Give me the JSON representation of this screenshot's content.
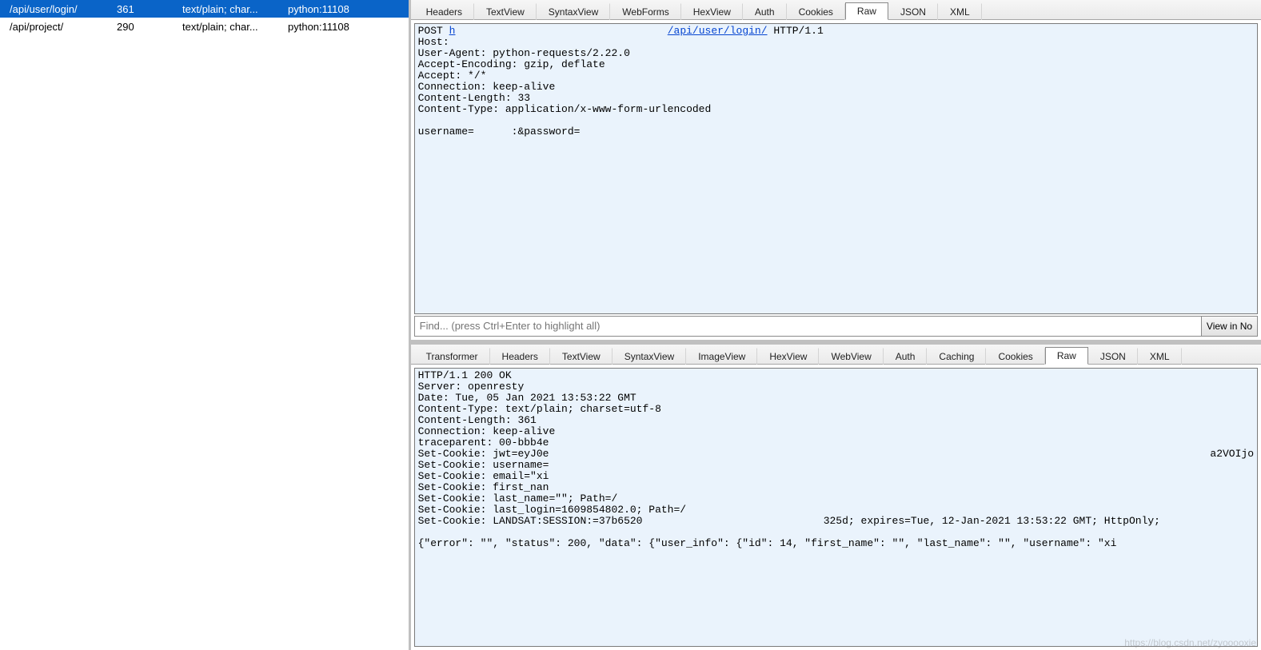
{
  "sessions": {
    "rows": [
      {
        "url": "/api/user/login/",
        "size": "361",
        "content_type": "text/plain; char...",
        "process": "python:11108",
        "selected": true
      },
      {
        "url": "/api/project/",
        "size": "290",
        "content_type": "text/plain; char...",
        "process": "python:11108",
        "selected": false
      }
    ]
  },
  "request": {
    "tabs": [
      "Headers",
      "TextView",
      "SyntaxView",
      "WebForms",
      "HexView",
      "Auth",
      "Cookies",
      "Raw",
      "JSON",
      "XML"
    ],
    "active_tab": "Raw",
    "raw": {
      "method": "POST",
      "link_left": "h",
      "link_right": "/api/user/login/",
      "http": " HTTP/1.1",
      "lines_after": "Host:\nUser-Agent: python-requests/2.22.0\nAccept-Encoding: gzip, deflate\nAccept: */*\nConnection: keep-alive\nContent-Length: 33\nContent-Type: application/x-www-form-urlencoded\n\nusername=      :&password="
    },
    "find_placeholder": "Find... (press Ctrl+Enter to highlight all)",
    "view_in_btn": "View in No"
  },
  "response": {
    "tabs": [
      "Transformer",
      "Headers",
      "TextView",
      "SyntaxView",
      "ImageView",
      "HexView",
      "WebView",
      "Auth",
      "Caching",
      "Cookies",
      "Raw",
      "JSON",
      "XML"
    ],
    "active_tab": "Raw",
    "raw": "HTTP/1.1 200 OK\nServer: openresty\nDate: Tue, 05 Jan 2021 13:53:22 GMT\nContent-Type: text/plain; charset=utf-8\nContent-Length: 361\nConnection: keep-alive\ntraceparent: 00-bbb4e\nSet-Cookie: jwt=eyJ0e                                                                                                          a2VOIjo\nSet-Cookie: username=\nSet-Cookie: email=\"xi\nSet-Cookie: first_nan\nSet-Cookie: last_name=\"\"; Path=/\nSet-Cookie: last_login=1609854802.0; Path=/\nSet-Cookie: LANDSAT:SESSION:=37b6520                             325d; expires=Tue, 12-Jan-2021 13:53:22 GMT; HttpOnly;\n\n{\"error\": \"\", \"status\": 200, \"data\": {\"user_info\": {\"id\": 14, \"first_name\": \"\", \"last_name\": \"\", \"username\": \"xi"
  },
  "watermark": "https://blog.csdn.net/zyooooxie"
}
